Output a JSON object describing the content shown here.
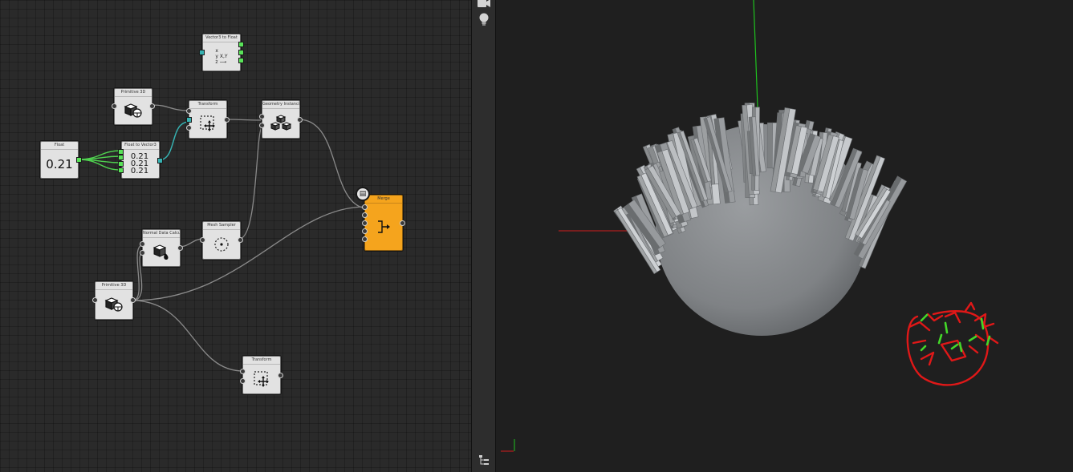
{
  "graph": {
    "nodes": [
      {
        "id": "vec2f",
        "title": "Vector3 to Float",
        "lines": [
          "x",
          "y   X,Y",
          "z  ⟶"
        ]
      },
      {
        "id": "prim1",
        "title": "Primitive 3D",
        "icon": "primitive-icon"
      },
      {
        "id": "transform1",
        "title": "Transform",
        "icon": "transform-icon"
      },
      {
        "id": "geo",
        "title": "Geometry Instancing",
        "icon": "instancing-icon"
      },
      {
        "id": "float",
        "title": "Float",
        "value": "0.21"
      },
      {
        "id": "f2v",
        "title": "Float to Vector3",
        "values": [
          "0.21",
          "0.21",
          "0.21"
        ]
      },
      {
        "id": "merge",
        "title": "Merge",
        "icon": "merge-icon"
      },
      {
        "id": "normals",
        "title": "Normal Data Calculation",
        "icon": "normals-icon"
      },
      {
        "id": "mesh",
        "title": "Mesh Sampler",
        "icon": "sampler-icon"
      },
      {
        "id": "prim2",
        "title": "Primitive 3D",
        "icon": "primitive-icon"
      },
      {
        "id": "transform2",
        "title": "Transform",
        "icon": "transform-icon"
      }
    ]
  },
  "sidebar": {
    "camera_icon": "camera-icon",
    "light_icon": "lightbulb-icon",
    "hierarchy_icon": "hierarchy-icon"
  },
  "viewport": {
    "axis_colors": {
      "x": "#d21e1e",
      "y": "#1fc21f",
      "z": "#2b58d8"
    },
    "mesh_color": "#888b8e",
    "doodle_colors": {
      "outline": "#e01818",
      "marks": "#43d829"
    }
  },
  "colors": {
    "node": "#e2e2e2",
    "merge_node": "#f5a41d",
    "port_float": "#59e359",
    "port_vector": "#36b2b2",
    "wire": "#7a7a7a"
  }
}
